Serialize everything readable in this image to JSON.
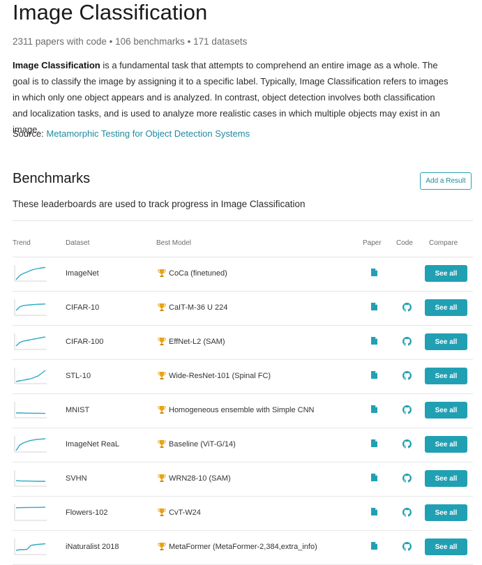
{
  "header": {
    "title": "Image Classification",
    "stats": "2311 papers with code • 106 benchmarks • 171 datasets"
  },
  "description": {
    "bold": "Image Classification",
    "text": " is a fundamental task that attempts to comprehend an entire image as a whole. The goal is to classify the image by assigning it to a specific label. Typically, Image Classification refers to images in which only one object appears and is analyzed. In contrast, object detection involves both classification and localization tasks, and is used to analyze more realistic cases in which multiple objects may exist in an image."
  },
  "source": {
    "label": "Source: ",
    "link": "Metamorphic Testing for Object Detection Systems"
  },
  "benchmarks": {
    "title": "Benchmarks",
    "add_result_label": "Add a Result",
    "subtitle": "These leaderboards are used to track progress in Image Classification",
    "columns": {
      "trend": "Trend",
      "dataset": "Dataset",
      "best_model": "Best Model",
      "paper": "Paper",
      "code": "Code",
      "compare": "Compare"
    },
    "see_all_label": "See all",
    "accent_color": "#21a0b3",
    "trend_color": "#2aa8c4",
    "rows": [
      {
        "dataset": "ImageNet",
        "model": "CoCa (finetuned)",
        "has_code": false,
        "trend": [
          0.05,
          0.35,
          0.5,
          0.6,
          0.72,
          0.8,
          0.85,
          0.9,
          0.93
        ]
      },
      {
        "dataset": "CIFAR-10",
        "model": "CaIT-M-36 U 224",
        "has_code": true,
        "trend": [
          0.3,
          0.55,
          0.65,
          0.68,
          0.7,
          0.72,
          0.74,
          0.75,
          0.76
        ]
      },
      {
        "dataset": "CIFAR-100",
        "model": "EffNet-L2 (SAM)",
        "has_code": true,
        "trend": [
          0.2,
          0.45,
          0.55,
          0.6,
          0.65,
          0.7,
          0.75,
          0.8,
          0.85
        ]
      },
      {
        "dataset": "STL-10",
        "model": "Wide-ResNet-101 (Spinal FC)",
        "has_code": true,
        "trend": [
          0.1,
          0.15,
          0.2,
          0.25,
          0.3,
          0.4,
          0.5,
          0.7,
          0.9
        ]
      },
      {
        "dataset": "MNIST",
        "model": "Homogeneous ensemble with Simple CNN",
        "has_code": true,
        "trend": [
          0.3,
          0.3,
          0.29,
          0.29,
          0.28,
          0.28,
          0.28,
          0.27,
          0.27
        ]
      },
      {
        "dataset": "ImageNet ReaL",
        "model": "Baseline (ViT-G/14)",
        "has_code": true,
        "trend": [
          0.05,
          0.45,
          0.6,
          0.7,
          0.78,
          0.82,
          0.86,
          0.88,
          0.9
        ]
      },
      {
        "dataset": "SVHN",
        "model": "WRN28-10 (SAM)",
        "has_code": true,
        "trend": [
          0.35,
          0.33,
          0.32,
          0.32,
          0.31,
          0.31,
          0.3,
          0.3,
          0.3
        ]
      },
      {
        "dataset": "Flowers-102",
        "model": "CvT-W24",
        "has_code": true,
        "trend": [
          0.85,
          0.86,
          0.87,
          0.87,
          0.88,
          0.88,
          0.88,
          0.89,
          0.89
        ]
      },
      {
        "dataset": "iNaturalist 2018",
        "model": "MetaFormer (MetaFormer-2,384,extra_info)",
        "has_code": true,
        "trend": [
          0.25,
          0.3,
          0.3,
          0.32,
          0.6,
          0.65,
          0.68,
          0.7,
          0.72
        ]
      }
    ]
  }
}
